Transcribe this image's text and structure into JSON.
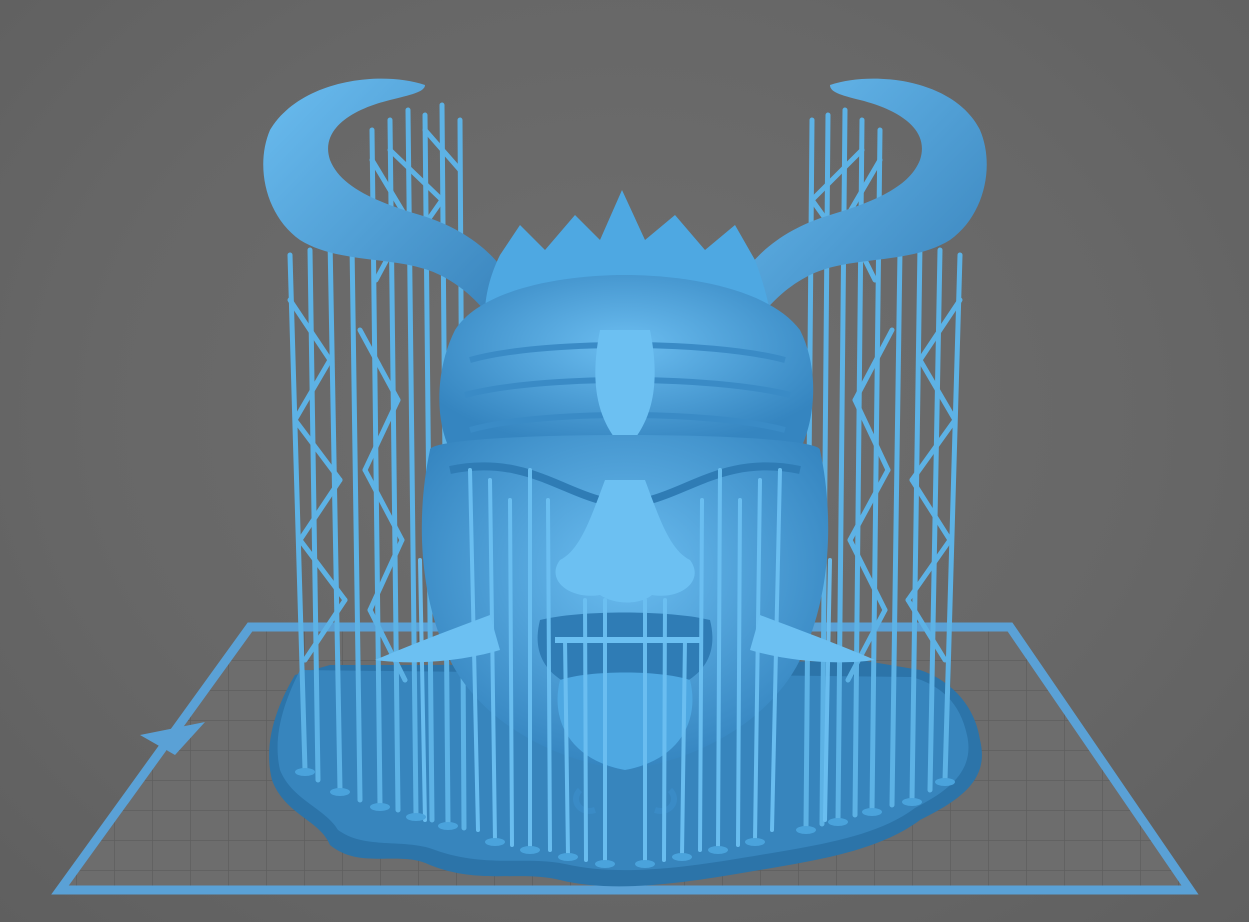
{
  "viewport": {
    "background": "#686868",
    "plate_border_color": "#5a9fd4",
    "plate_fill_color": "#6e6e6e",
    "grid_line_color": "#5a5a5a",
    "model_color": "#4aa3dc",
    "model_dark_color": "#2f7fb8",
    "raft_color": "#2e78ad",
    "support_color": "#5fb4e6"
  },
  "scene_objects": {
    "build_plate": "build-plate",
    "model": "demon-mask-model",
    "supports": "support-structures",
    "raft": "raft-base"
  }
}
